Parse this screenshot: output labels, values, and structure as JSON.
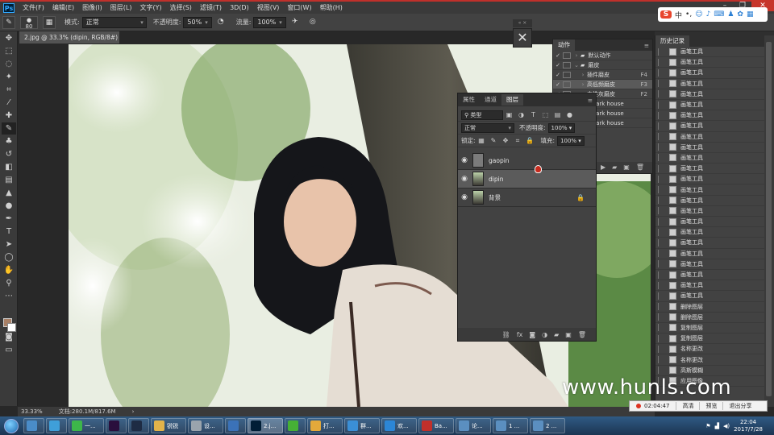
{
  "menubar": {
    "logo": "Ps",
    "items": [
      "文件(F)",
      "编辑(E)",
      "图像(I)",
      "图层(L)",
      "文字(Y)",
      "选择(S)",
      "滤镜(T)",
      "3D(D)",
      "视图(V)",
      "窗口(W)",
      "帮助(H)"
    ],
    "window_controls": [
      "–",
      "❐",
      "✕"
    ]
  },
  "options": {
    "brush_size": "80",
    "mode_label": "模式:",
    "mode_value": "正常",
    "opacity_label": "不透明度:",
    "opacity_value": "50%",
    "flow_label": "流量:",
    "flow_value": "100%"
  },
  "sogou": {
    "logo": "S",
    "lang": "中"
  },
  "document": {
    "tab_title": "2.jpg @ 33.3% (dipin, RGB/8#) *",
    "zoom": "33.33%",
    "doc_size": "文档:280.1M/817.6M"
  },
  "actions_panel": {
    "tab": "动作",
    "rows": [
      {
        "label": "默认动作",
        "check": "✓",
        "key": ""
      },
      {
        "label": "磨皮",
        "check": "✓",
        "key": ""
      },
      {
        "label": "插件磨皮",
        "check": "✓",
        "key": "F4"
      },
      {
        "label": "高低频磨皮",
        "check": "✓",
        "key": "F3"
      },
      {
        "label": "中性灰磨皮",
        "check": "✓",
        "key": "F2"
      },
      {
        "label": "S dark house",
        "check": "✓",
        "key": ""
      },
      {
        "label": "S dark house",
        "check": "✓",
        "key": ""
      },
      {
        "label": "S dark house",
        "check": "✓",
        "key": ""
      }
    ]
  },
  "layers_panel": {
    "tabs": [
      "属性",
      "通道",
      "图层"
    ],
    "filter_label": "类型",
    "blend_mode": "正常",
    "opacity_label": "不透明度:",
    "opacity_value": "100%",
    "lock_label": "锁定:",
    "fill_label": "填充:",
    "fill_value": "100%",
    "layers": [
      {
        "name": "gaopin",
        "selected": false,
        "locked": false
      },
      {
        "name": "dipin",
        "selected": true,
        "locked": false
      },
      {
        "name": "背景",
        "selected": false,
        "locked": true
      }
    ],
    "footer_icons": [
      "link-icon",
      "fx-icon",
      "mask-icon",
      "adjustment-icon",
      "group-icon",
      "new-layer-icon",
      "trash-icon"
    ]
  },
  "history_panel": {
    "tab": "历史记录",
    "items": [
      "画笔工具",
      "画笔工具",
      "画笔工具",
      "画笔工具",
      "画笔工具",
      "画笔工具",
      "画笔工具",
      "画笔工具",
      "画笔工具",
      "画笔工具",
      "画笔工具",
      "画笔工具",
      "画笔工具",
      "画笔工具",
      "画笔工具",
      "画笔工具",
      "画笔工具",
      "画笔工具",
      "画笔工具",
      "画笔工具",
      "画笔工具",
      "画笔工具",
      "画笔工具",
      "画笔工具",
      "删除图层",
      "删除图层",
      "复制图层",
      "复制图层",
      "名称更改",
      "名称更改",
      "高斯模糊",
      "应用图像"
    ]
  },
  "recording": {
    "time": "02:04:47",
    "buttons": [
      "高清",
      "预览",
      "退出分享"
    ]
  },
  "watermark": "www.hunls.com",
  "taskbar": {
    "items": [
      {
        "label": "",
        "color": "#4a8cc8"
      },
      {
        "label": "",
        "color": "#3f9fd9"
      },
      {
        "label": "一...",
        "color": "#3db64a"
      },
      {
        "label": "",
        "color": "#2a0f3d"
      },
      {
        "label": "",
        "color": "#1e2c44"
      },
      {
        "label": "锐锐",
        "color": "#e2b34a"
      },
      {
        "label": "设...",
        "color": "#9aa4ad"
      },
      {
        "label": "",
        "color": "#3b72b8"
      },
      {
        "label": "2.j...",
        "color": "#001e36"
      },
      {
        "label": "",
        "color": "#46b035"
      },
      {
        "label": "打...",
        "color": "#e3a93b"
      },
      {
        "label": "群...",
        "color": "#3a8fd6"
      },
      {
        "label": "欢...",
        "color": "#2c86d6"
      },
      {
        "label": "Ba...",
        "color": "#c0302b"
      },
      {
        "label": "论...",
        "color": "#5b8fc0"
      },
      {
        "label": "1 ...",
        "color": "#5b8fc0"
      },
      {
        "label": "2 ...",
        "color": "#5b8fc0"
      }
    ],
    "clock_time": "22:04",
    "clock_date": "2017/7/28"
  }
}
